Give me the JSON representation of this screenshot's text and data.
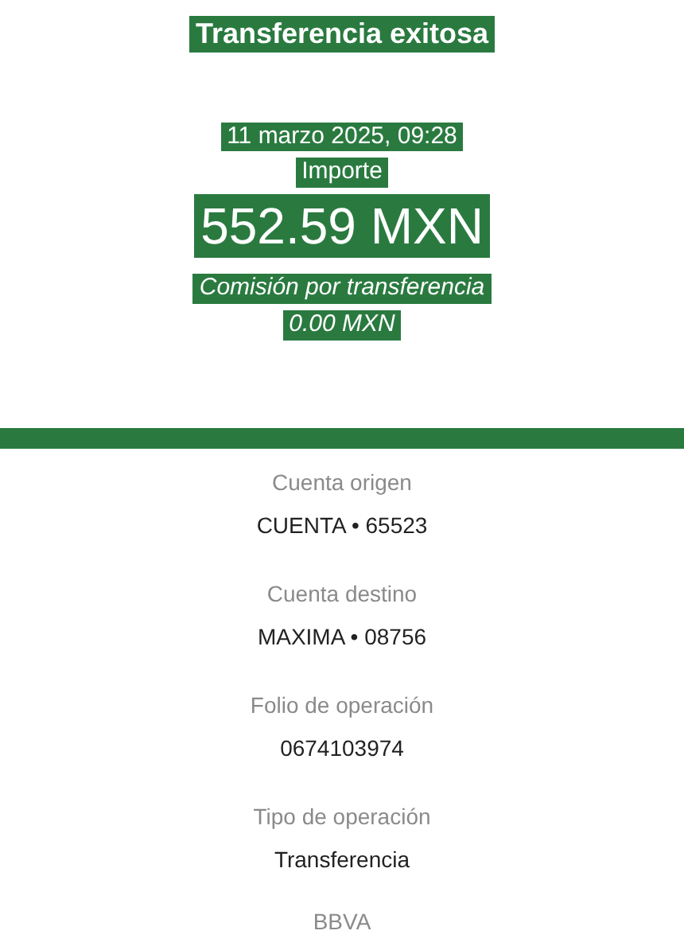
{
  "title": "Transferencia exitosa",
  "date": "11 marzo 2025, 09:28",
  "amount_label": "Importe",
  "amount": "552.59 MXN",
  "fee_label": "Comisión por transferencia",
  "fee": "0.00 MXN",
  "details": [
    {
      "label": "Cuenta origen",
      "value": "CUENTA • 65523"
    },
    {
      "label": "Cuenta destino",
      "value": "MAXIMA • 08756"
    },
    {
      "label": "Folio de operación",
      "value": "0674103974"
    },
    {
      "label": "Tipo de operación",
      "value": "Transferencia"
    }
  ],
  "bank": "BBVA"
}
